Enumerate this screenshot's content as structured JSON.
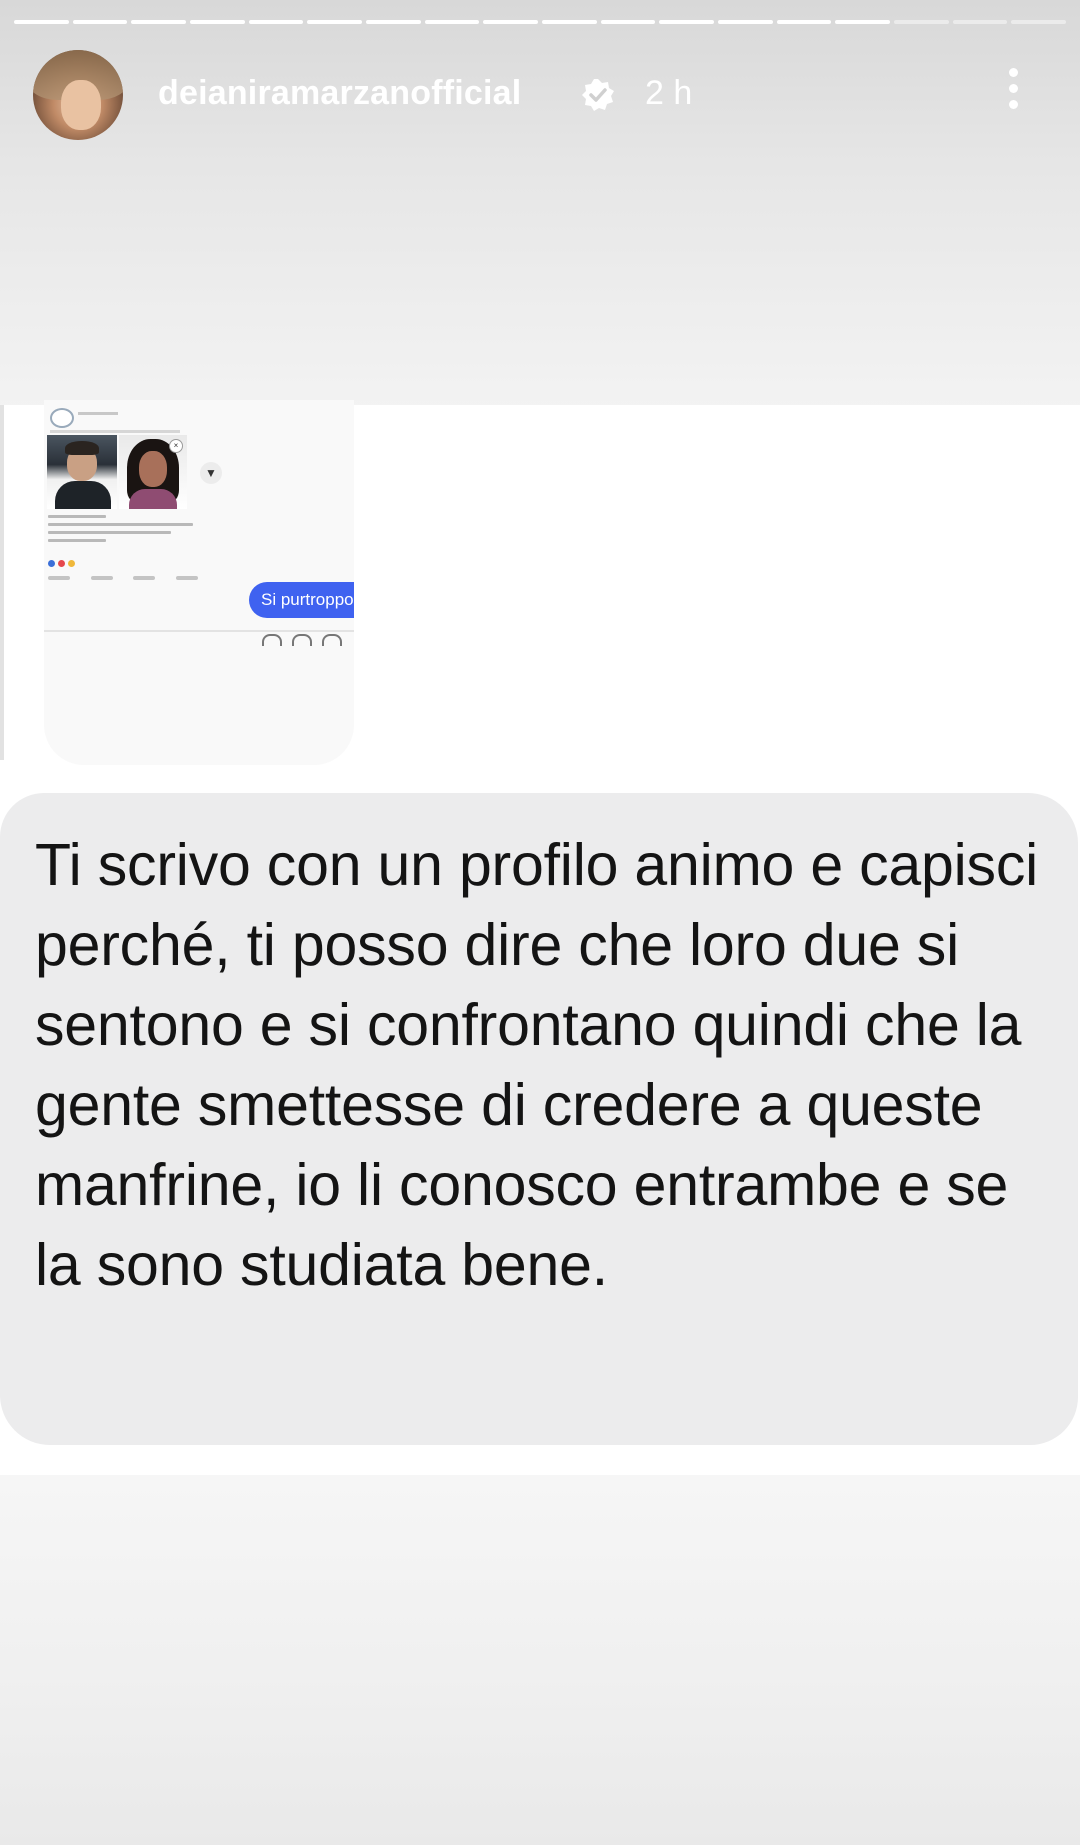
{
  "story": {
    "progress_segments_total": 18,
    "progress_segments_done": 15
  },
  "header": {
    "avatar_icon": "avatar",
    "username": "deianiramarzanofficial",
    "verified_icon": "verified-badge-icon",
    "time_ago": "2 h",
    "more_icon": "more-vertical-icon"
  },
  "embedded_screenshot": {
    "sent_message": "Si purtroppo",
    "bubble_color": "#3f62f0"
  },
  "message": {
    "text": "Ti scrivo con un profilo animo e capisci perché, ti posso dire che loro due si sentono e si confrontano quindi che la gente smettesse di credere a queste manfrine, io li conosco entrambe e se la sono studiata bene.",
    "bubble_color": "#ececed",
    "text_color": "#141414"
  }
}
